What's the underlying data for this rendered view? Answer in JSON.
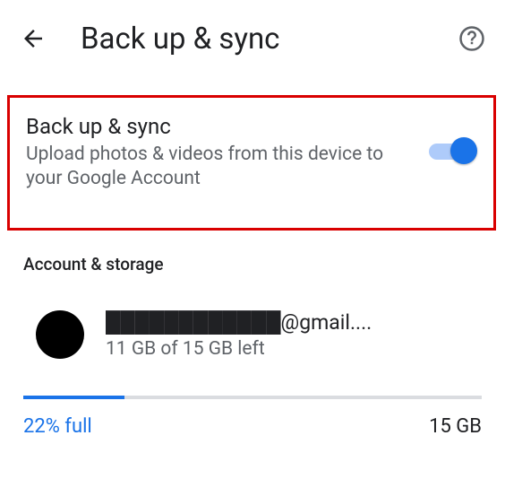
{
  "appbar": {
    "title": "Back up & sync"
  },
  "backup_sync": {
    "title": "Back up & sync",
    "description": "Upload photos & videos from this device to your Google Account",
    "enabled": true
  },
  "section_header": "Account & storage",
  "account": {
    "email_display": "████████████@gmail....",
    "storage_line": "11 GB of 15 GB left"
  },
  "progress": {
    "percent_label": "22% full",
    "total_label": "15 GB",
    "fill_percent": 22
  }
}
